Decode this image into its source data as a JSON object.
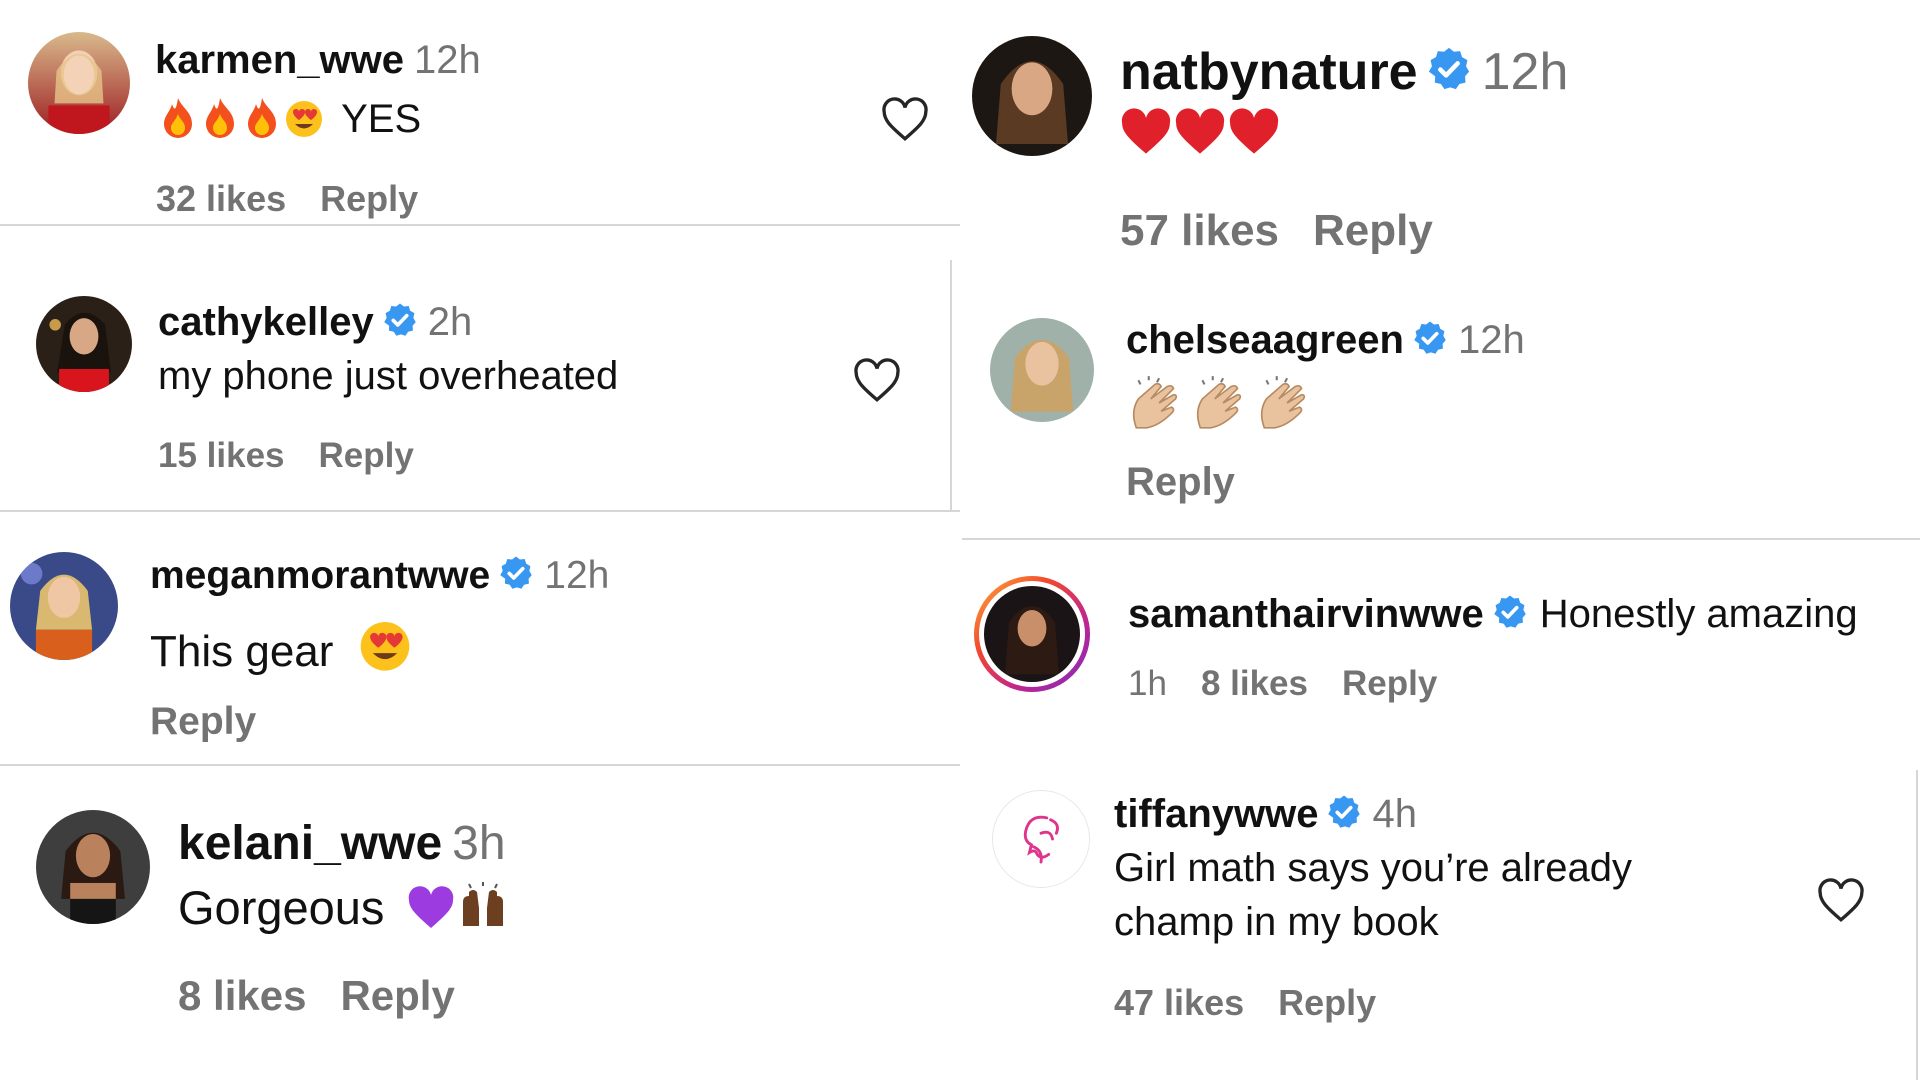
{
  "comments": [
    {
      "username": "karmen_wwe",
      "time": "12h",
      "text": "YES",
      "likes": "32 likes",
      "reply": "Reply"
    },
    {
      "username": "cathykelley",
      "time": "2h",
      "text": "my phone just overheated",
      "likes": "15 likes",
      "reply": "Reply"
    },
    {
      "username": "meganmorantwwe",
      "time": "12h",
      "text": "This gear",
      "reply": "Reply"
    },
    {
      "username": "kelani_wwe",
      "time": "3h",
      "text": "Gorgeous",
      "likes": "8 likes",
      "reply": "Reply"
    },
    {
      "username": "natbynature",
      "time": "12h",
      "likes": "57 likes",
      "reply": "Reply"
    },
    {
      "username": "chelseaagreen",
      "time": "12h",
      "reply": "Reply"
    },
    {
      "username": "samanthairvinwwe",
      "text": "Honestly amazing",
      "time": "1h",
      "likes": "8 likes",
      "reply": "Reply"
    },
    {
      "username": "tiffanywwe",
      "time": "4h",
      "text_line1": "Girl math says you’re already",
      "text_line2": "champ in my book",
      "likes": "47 likes",
      "reply": "Reply"
    }
  ],
  "icons": {
    "heart": "heart-outline-icon",
    "verified": "verified-badge-icon",
    "fire": "fire-emoji",
    "heart_eyes": "heart-eyes-emoji",
    "red_heart": "red-heart-emoji",
    "clap": "clapping-hands-emoji",
    "purple_heart": "purple-heart-emoji",
    "raised_hands": "raising-hands-emoji"
  },
  "colors": {
    "verified_blue": "#3897f0",
    "muted": "#737373",
    "divider": "#d6d6d6"
  }
}
